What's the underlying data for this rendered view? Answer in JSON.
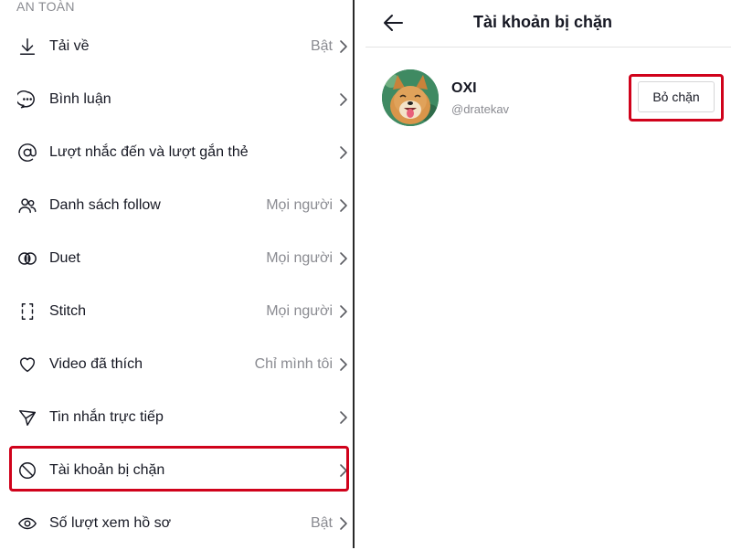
{
  "left": {
    "section_header": "AN TOÀN",
    "items": [
      {
        "label": "Tải về",
        "value": "Bật",
        "icon": "download-icon"
      },
      {
        "label": "Bình luận",
        "value": "",
        "icon": "comment-icon"
      },
      {
        "label": "Lượt nhắc đến và lượt gắn thẻ",
        "value": "",
        "icon": "mention-icon"
      },
      {
        "label": "Danh sách follow",
        "value": "Mọi người",
        "icon": "people-icon"
      },
      {
        "label": "Duet",
        "value": "Mọi người",
        "icon": "duet-icon"
      },
      {
        "label": "Stitch",
        "value": "Mọi người",
        "icon": "stitch-icon"
      },
      {
        "label": "Video đã thích",
        "value": "Chỉ mình tôi",
        "icon": "heart-icon"
      },
      {
        "label": "Tin nhắn trực tiếp",
        "value": "",
        "icon": "send-icon"
      },
      {
        "label": "Tài khoản bị chặn",
        "value": "",
        "icon": "block-icon"
      },
      {
        "label": "Số lượt xem hồ sơ",
        "value": "Bật",
        "icon": "eye-icon"
      }
    ]
  },
  "right": {
    "title": "Tài khoản bị chặn",
    "blocked_user": {
      "name": "OXI",
      "handle": "@dratekav",
      "button_label": "Bỏ chặn"
    }
  },
  "colors": {
    "highlight": "#d0021b",
    "text_primary": "#161823",
    "text_secondary": "#8a8b91"
  }
}
